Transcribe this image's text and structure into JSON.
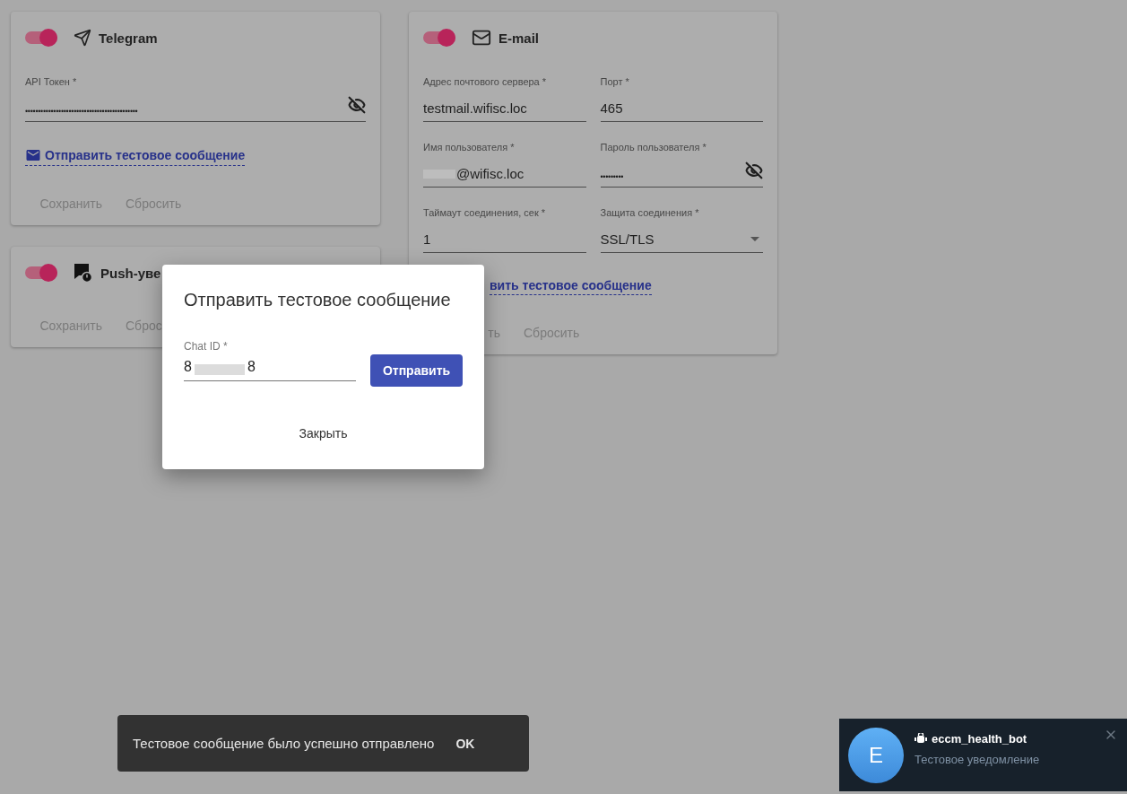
{
  "columns": [
    {
      "cards": [
        {
          "kind": "telegram",
          "enabled": true,
          "title": "Telegram",
          "fields": [
            {
              "kind": "password",
              "label": "API Токен *",
              "value": "••••••••••••••••••••••••••••••••••••••••••••"
            }
          ],
          "link": "Отправить тестовое сообщение",
          "buttons": [
            "Сохранить",
            "Сбросить"
          ]
        },
        {
          "kind": "push",
          "enabled": true,
          "title": "Push-уве",
          "buttons": [
            "Сохранить",
            "Сброс"
          ]
        }
      ]
    },
    {
      "cards": [
        {
          "kind": "email",
          "enabled": true,
          "title": "E-mail",
          "fields": [
            {
              "kind": "text",
              "label": "Адрес почтового сервера *",
              "value": "testmail.wifisc.loc"
            },
            {
              "kind": "text",
              "label": "Порт *",
              "value": "465"
            },
            {
              "kind": "redacted",
              "label": "Имя пользователя *",
              "value": "@wifisc.loc"
            },
            {
              "kind": "password",
              "label": "Пароль пользователя *",
              "value": "•••••••••"
            },
            {
              "kind": "text",
              "label": "Таймаут соединения, сек *",
              "value": "1"
            },
            {
              "kind": "select",
              "label": "Защита соединения *",
              "value": "SSL/TLS"
            }
          ],
          "link": "вить тестовое сообщение",
          "buttons": [
            "ть",
            "Сбросить"
          ]
        }
      ]
    }
  ],
  "dialog": {
    "title": "Отправить тестовое сообщение",
    "field": {
      "label": "Chat ID *",
      "value_start": "8",
      "value_end": "8"
    },
    "submit": "Отправить",
    "close": "Закрыть"
  },
  "snackbar": {
    "message": "Тестовое сообщение было успешно отправлено",
    "action": "OK"
  },
  "notification": {
    "avatar": "E",
    "title": "eccm_health_bot",
    "message": "Тестовое уведомление"
  }
}
